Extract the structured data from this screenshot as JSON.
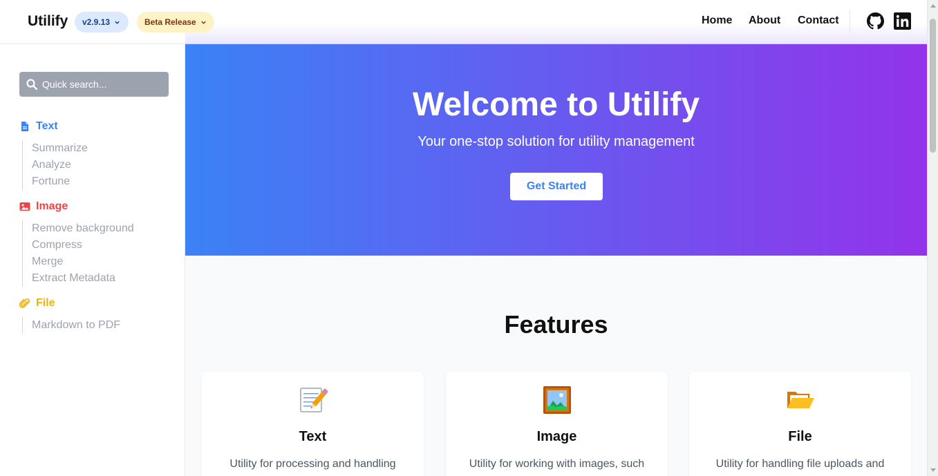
{
  "header": {
    "logo": "Utilify",
    "version_label": "v2.9.13",
    "release_label": "Beta Release",
    "nav": [
      "Home",
      "About",
      "Contact"
    ],
    "icons": [
      "github-icon",
      "linkedin-icon"
    ]
  },
  "sidebar": {
    "search_placeholder": "Quick search...",
    "sections": [
      {
        "label": "Text",
        "icon": "document-icon",
        "color": "#3b82f6",
        "items": [
          "Summarize",
          "Analyze",
          "Fortune"
        ]
      },
      {
        "label": "Image",
        "icon": "image-icon",
        "color": "#ef4444",
        "items": [
          "Remove background",
          "Compress",
          "Merge",
          "Extract Metadata"
        ]
      },
      {
        "label": "File",
        "icon": "paperclip-icon",
        "color": "#eab308",
        "items": [
          "Markdown to PDF"
        ]
      }
    ]
  },
  "hero": {
    "title": "Welcome to Utilify",
    "subtitle": "Your one-stop solution for utility management",
    "cta": "Get Started",
    "gradient_from": "#3b82f6",
    "gradient_to": "#9333ea"
  },
  "features": {
    "title": "Features",
    "cards": [
      {
        "icon": "memo-icon",
        "title": "Text",
        "desc": "Utility for processing and handling"
      },
      {
        "icon": "framed-picture-icon",
        "title": "Image",
        "desc": "Utility for working with images, such"
      },
      {
        "icon": "open-folder-icon",
        "title": "File",
        "desc": "Utility for handling file uploads and"
      }
    ]
  }
}
